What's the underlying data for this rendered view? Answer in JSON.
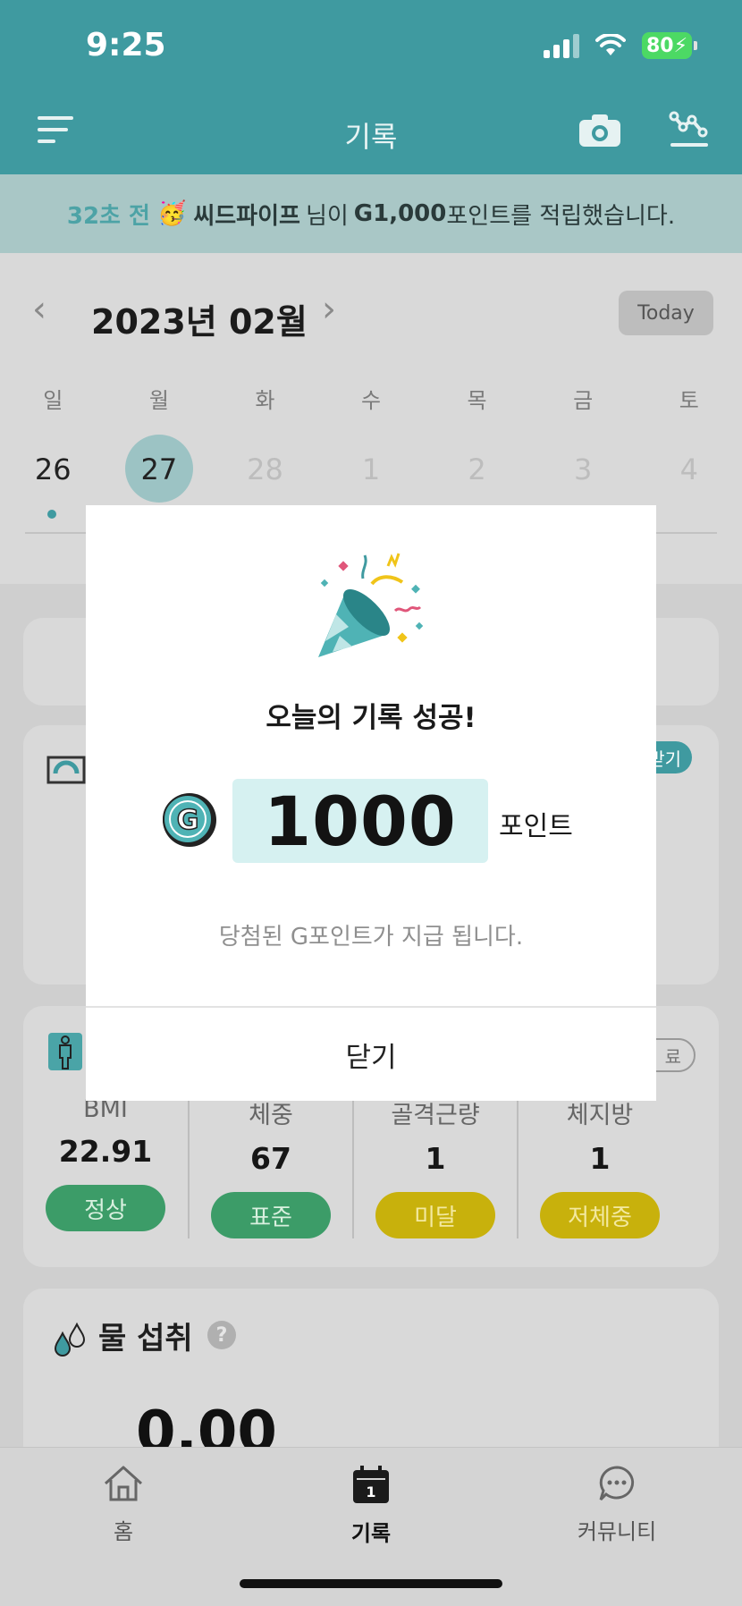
{
  "status_bar": {
    "time": "9:25",
    "battery": "80"
  },
  "header": {
    "title": "기록"
  },
  "ticker": {
    "time_ago": "32초 전",
    "emoji": "🥳",
    "user": "씨드파이프",
    "text_1": "님이",
    "amount": "G1,000",
    "text_2": "포인트를 적립했습니다."
  },
  "calendar": {
    "month": "2023년 02월",
    "today_label": "Today",
    "weekdays": [
      "일",
      "월",
      "화",
      "수",
      "목",
      "금",
      "토"
    ],
    "dates": [
      "26",
      "27",
      "28",
      "1",
      "2",
      "3",
      "4"
    ]
  },
  "cards": {
    "weight_badge": "받기",
    "body_badge": "료"
  },
  "stats": [
    {
      "label": "BMI",
      "value": "22.91",
      "status": "정상"
    },
    {
      "label": "체중",
      "value": "67",
      "status": "표준"
    },
    {
      "label": "골격근량",
      "value": "1",
      "status": "미달"
    },
    {
      "label": "체지방",
      "value": "1",
      "status": "저체중"
    }
  ],
  "water": {
    "title": "물 섭취",
    "help": "?",
    "amount": "0.00"
  },
  "modal": {
    "title": "오늘의 기록 성공!",
    "points": "1000",
    "points_unit": "포인트",
    "message": "당첨된 G포인트가 지급 됩니다.",
    "close_label": "닫기"
  },
  "nav": [
    {
      "label": "홈",
      "icon": "home-icon"
    },
    {
      "label": "기록",
      "icon": "calendar-icon"
    },
    {
      "label": "커뮤니티",
      "icon": "chat-icon"
    }
  ],
  "colors": {
    "teal": "#3f9aa0",
    "mint": "#d6f1f1",
    "green": "#3c9c68",
    "yellow": "#c8b10c"
  }
}
